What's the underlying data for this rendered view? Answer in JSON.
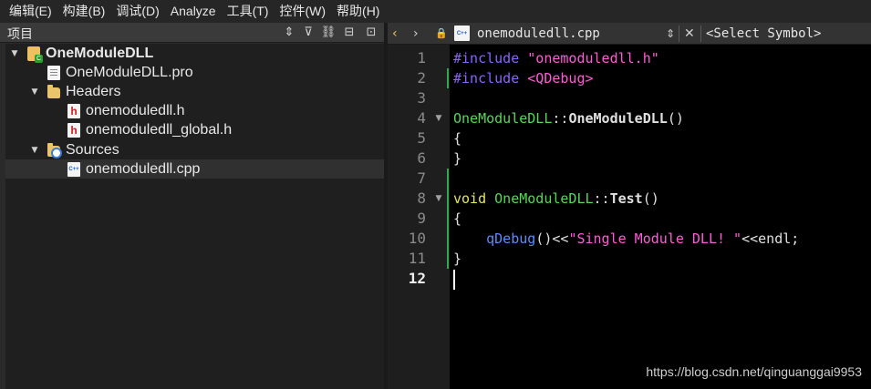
{
  "menubar": {
    "items": [
      "编辑(E)",
      "构建(B)",
      "调试(D)",
      "Analyze",
      "工具(T)",
      "控件(W)",
      "帮助(H)"
    ]
  },
  "project_panel": {
    "title": "项目",
    "tree": [
      {
        "label": "OneModuleDLL",
        "kind": "project",
        "indent": 0,
        "expanded": true
      },
      {
        "label": "OneModuleDLL.pro",
        "kind": "pro-file",
        "indent": 1
      },
      {
        "label": "Headers",
        "kind": "folder",
        "indent": 1,
        "expanded": true
      },
      {
        "label": "onemoduledll.h",
        "kind": "header",
        "indent": 2
      },
      {
        "label": "onemoduledll_global.h",
        "kind": "header",
        "indent": 2
      },
      {
        "label": "Sources",
        "kind": "folder-src",
        "indent": 1,
        "expanded": true
      },
      {
        "label": "onemoduledll.cpp",
        "kind": "cpp",
        "indent": 2,
        "selected": true
      }
    ]
  },
  "editor": {
    "filename": "onemoduledll.cpp",
    "symbol": "<Select Symbol>",
    "current_line": 12,
    "lines": [
      {
        "n": "1",
        "tokens": [
          [
            "pre",
            "#include "
          ],
          [
            "str",
            "\"onemoduledll.h\""
          ]
        ]
      },
      {
        "n": "2",
        "tokens": [
          [
            "pre",
            "#include "
          ],
          [
            "str",
            "<QDebug>"
          ]
        ]
      },
      {
        "n": "3",
        "tokens": []
      },
      {
        "n": "4",
        "tokens": [
          [
            "type",
            "OneModuleDLL"
          ],
          [
            "op",
            "::"
          ],
          [
            "fn",
            "OneModuleDLL"
          ],
          [
            "op",
            "()"
          ]
        ]
      },
      {
        "n": "5",
        "tokens": [
          [
            "op",
            "{"
          ]
        ]
      },
      {
        "n": "6",
        "tokens": [
          [
            "op",
            "}"
          ]
        ]
      },
      {
        "n": "7",
        "tokens": []
      },
      {
        "n": "8",
        "tokens": [
          [
            "kw",
            "void "
          ],
          [
            "type",
            "OneModuleDLL"
          ],
          [
            "op",
            "::"
          ],
          [
            "fn",
            "Test"
          ],
          [
            "op",
            "()"
          ]
        ]
      },
      {
        "n": "9",
        "tokens": [
          [
            "op",
            "{"
          ]
        ]
      },
      {
        "n": "10",
        "tokens": [
          [
            "op",
            "    "
          ],
          [
            "call",
            "qDebug"
          ],
          [
            "op",
            "()<<"
          ],
          [
            "str",
            "\"Single Module DLL! \""
          ],
          [
            "op",
            "<<endl;"
          ]
        ]
      },
      {
        "n": "11",
        "tokens": [
          [
            "op",
            "}"
          ]
        ]
      },
      {
        "n": "12",
        "tokens": []
      }
    ]
  },
  "watermark": "https://blog.csdn.net/qinguanggai9953"
}
